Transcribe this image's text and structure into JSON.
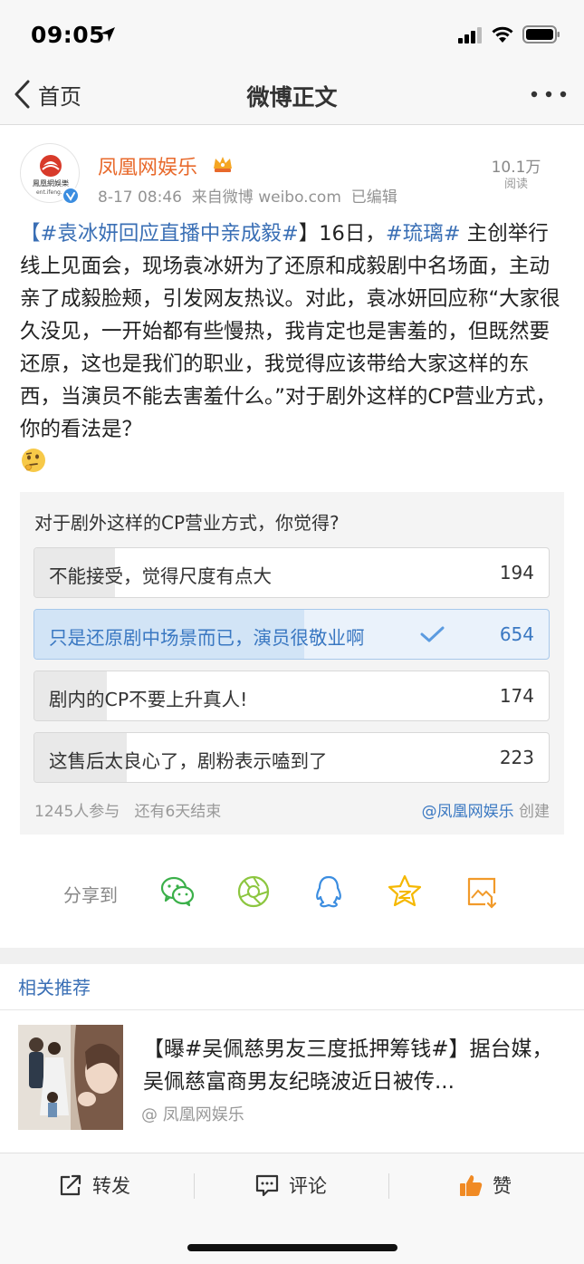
{
  "status_bar": {
    "time": "09:05"
  },
  "nav": {
    "back_label": "首页",
    "title": "微博正文"
  },
  "post": {
    "author": "凤凰网娱乐",
    "date": "8-17 08:46",
    "source": "来自微博 weibo.com",
    "edited": "已编辑",
    "read_count": "10.1万",
    "read_label": "阅读",
    "avatar_logo_text": "鳳凰網娛樂",
    "avatar_logo_domain": "ent.ifeng.c",
    "body": {
      "bracket_open": "【",
      "hashtag1": "#袁冰妍回应直播中亲成毅#",
      "text1": "】16日，",
      "hashtag2": "#琉璃#",
      "text2": " 主创举行线上见面会，现场袁冰妍为了还原和成毅剧中名场面，主动亲了成毅脸颊，引发网友热议。对此，袁冰妍回应称“大家很久没见，一开始都有些慢热，我肯定也是害羞的，但既然要还原，这也是我们的职业，我觉得应该带给大家这样的东西，当演员不能去害羞什么。”对于剧外这样的CP营业方式，你的看法是？"
    }
  },
  "poll": {
    "question": "对于剧外这样的CP营业方式，你觉得?",
    "options": [
      {
        "label": "不能接受，觉得尺度有点大",
        "count": "194",
        "fraction": 0.156,
        "selected": false
      },
      {
        "label": "只是还原剧中场景而已，演员很敬业啊",
        "count": "654",
        "fraction": 0.525,
        "selected": true
      },
      {
        "label": "剧内的CP不要上升真人!",
        "count": "174",
        "fraction": 0.14,
        "selected": false
      },
      {
        "label": "这售后太良心了，剧粉表示嗑到了",
        "count": "223",
        "fraction": 0.179,
        "selected": false
      }
    ],
    "participants": "1245人参与",
    "remaining": "还有6天结束",
    "creator_handle": "@凤凰网娱乐",
    "creator_suffix": " 创建"
  },
  "share": {
    "label": "分享到",
    "icons": [
      "wechat-icon",
      "moments-icon",
      "qq-icon",
      "qzone-icon",
      "save-image-icon"
    ],
    "colors": {
      "wechat": "#3bb04a",
      "moments": "#8cc63f",
      "qq": "#3b8de0",
      "qzone": "#f5b800",
      "save": "#f19a2a"
    }
  },
  "related": {
    "title": "相关推荐",
    "item": {
      "text": "【曝#吴佩慈男友三度抵押筹钱#】据台媒，吴佩慈富商男友纪晓波近日被传...",
      "author": "@ 凤凰网娱乐"
    }
  },
  "actions": {
    "repost": "转发",
    "comment": "评论",
    "like": "赞"
  },
  "colors": {
    "accent_blue": "#3a6fb5",
    "author_orange": "#e8692b",
    "like_orange": "#f08a24"
  }
}
